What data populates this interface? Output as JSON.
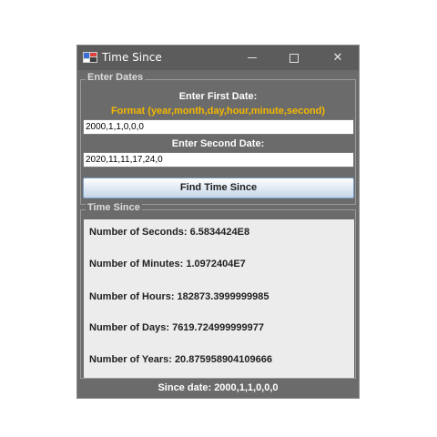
{
  "window": {
    "title": "Time Since",
    "icon": "app-icon"
  },
  "enter_dates": {
    "group_title": "Enter Dates",
    "first_label": "Enter First Date:",
    "format_hint": "Format (year,month,day,hour,minute,second)",
    "first_value": "2000,1,1,0,0,0",
    "second_label": "Enter Second Date:",
    "second_value": "2020,11,11,17,24,0",
    "button_label": "Find Time Since"
  },
  "time_since": {
    "group_title": "Time Since",
    "results": [
      "Number of Seconds:  6.5834424E8",
      "Number of Minutes:  1.0972404E7",
      "Number of Hours:  182873.3999999985",
      "Number of Days:  7619.724999999977",
      "Number of Years:  20.875958904109666"
    ],
    "since_text": "Since date: 2000,1,1,0,0,0"
  },
  "colors": {
    "accent_orange": "#f5b800",
    "window_bg": "#6b6b6b",
    "results_bg": "#ececec"
  }
}
